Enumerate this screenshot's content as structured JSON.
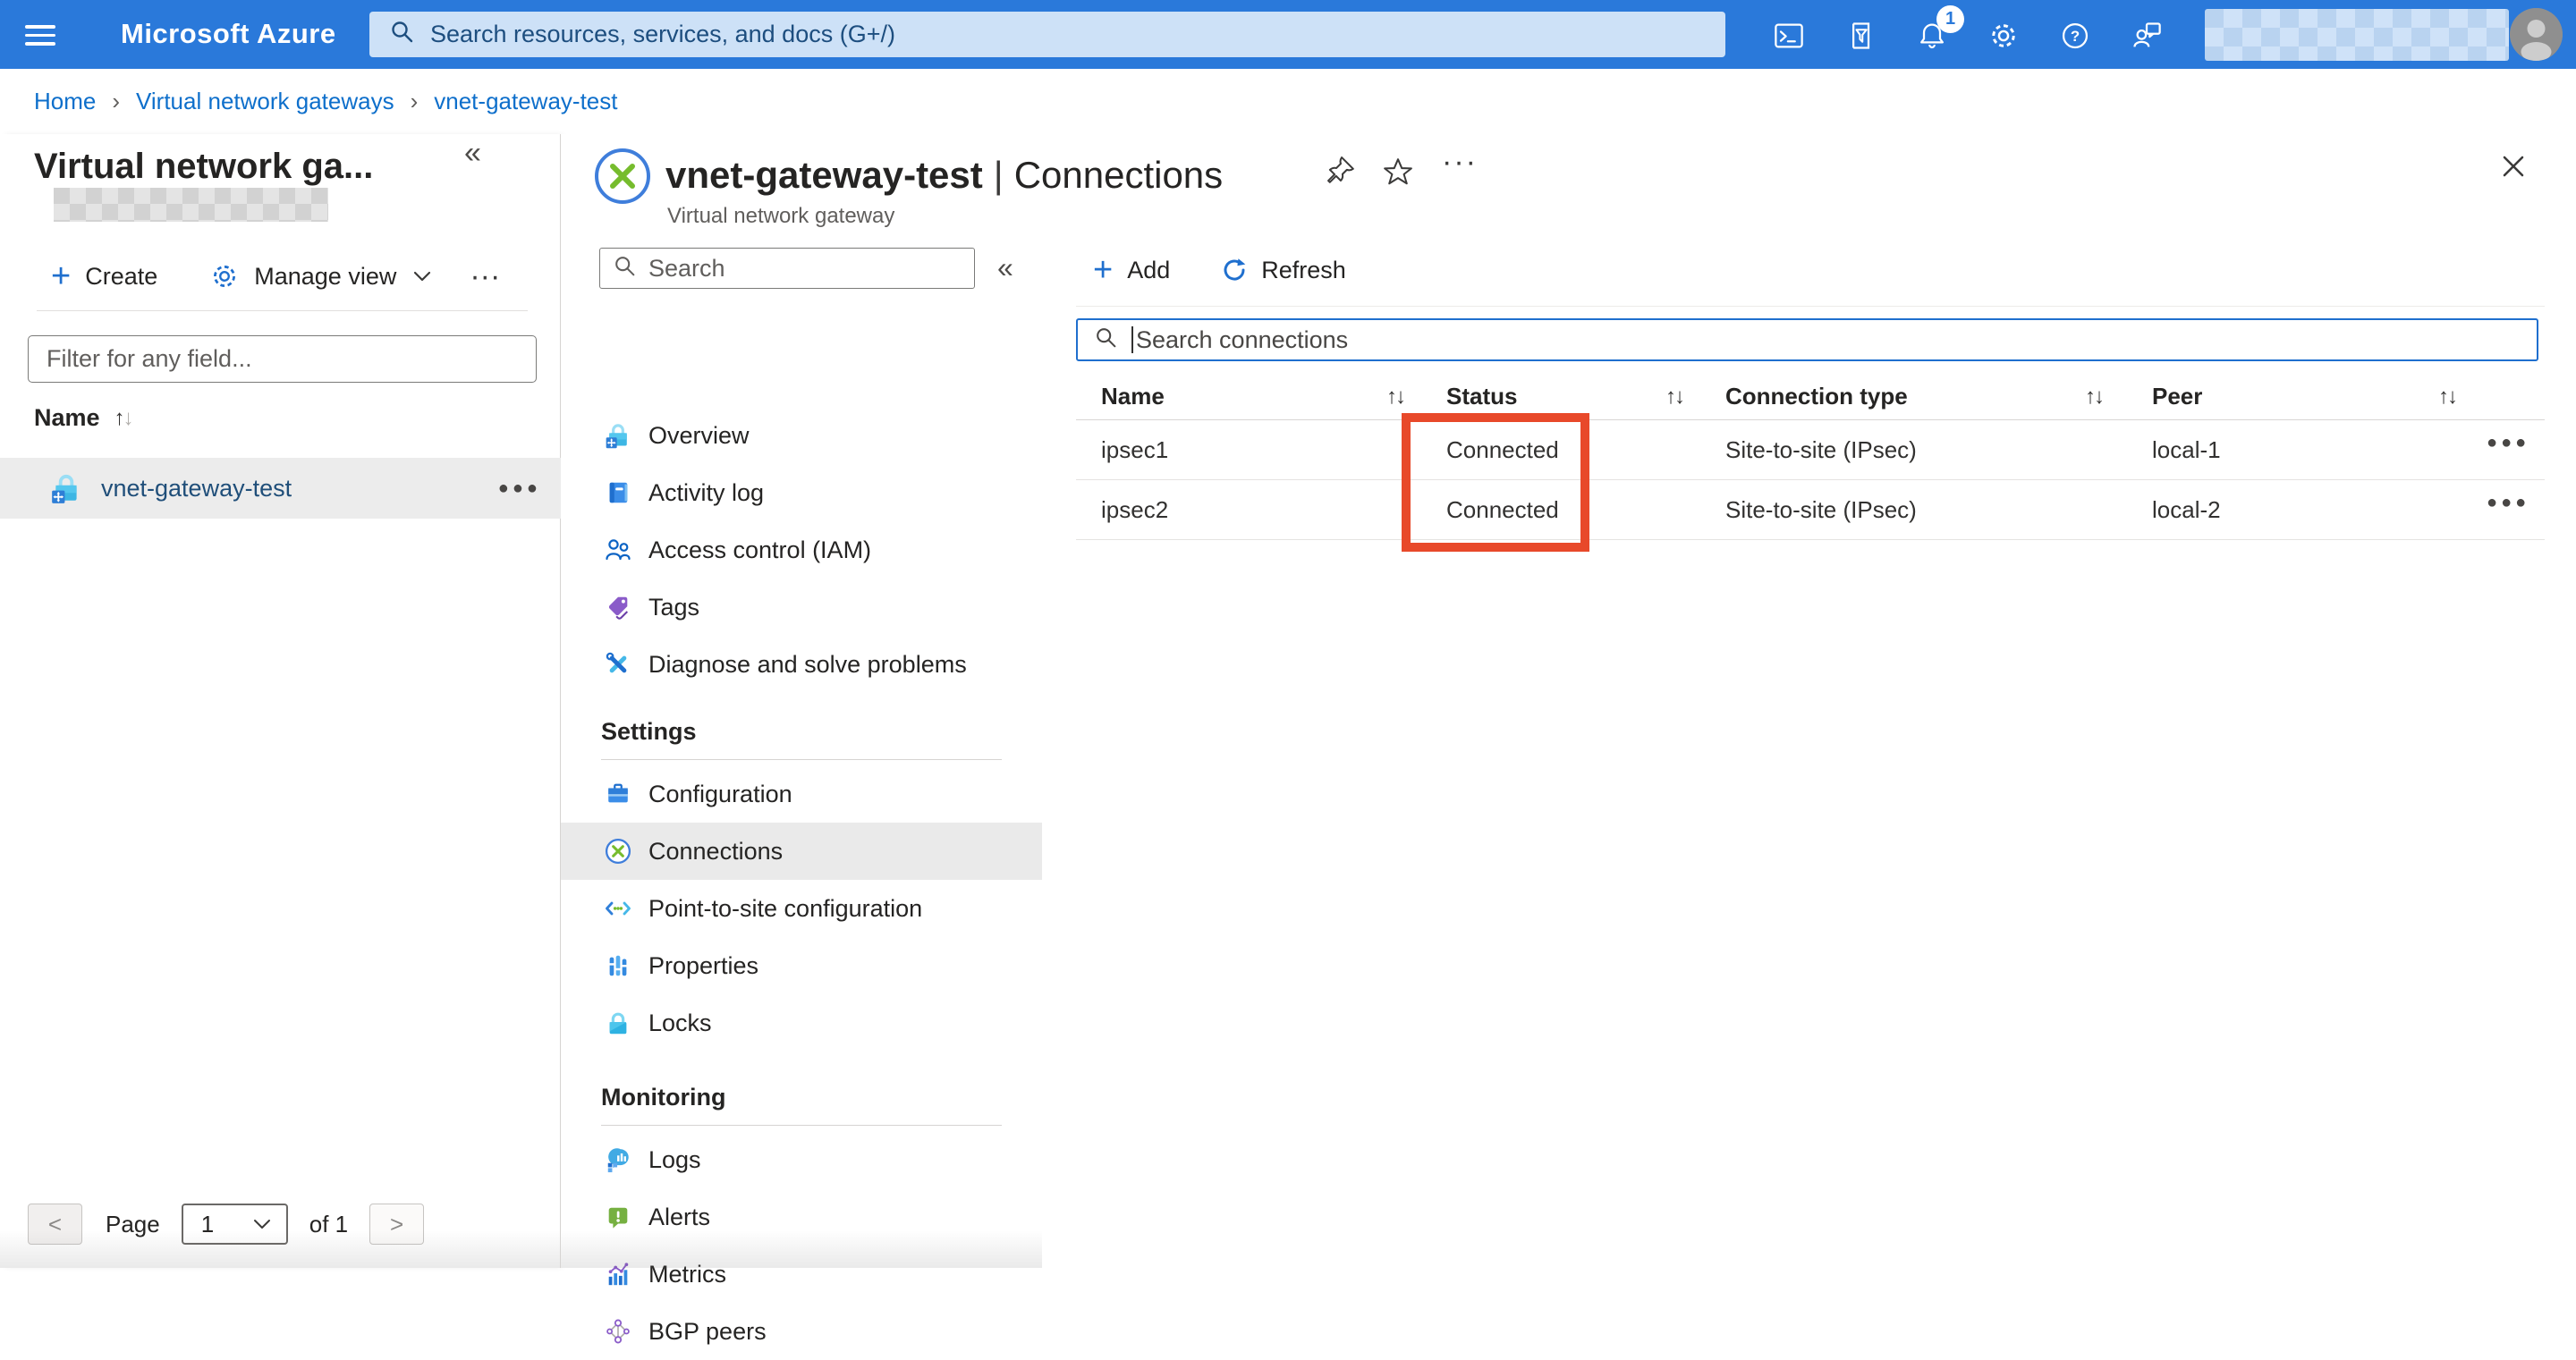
{
  "topbar": {
    "product": "Microsoft Azure",
    "search_placeholder": "Search resources, services, and docs (G+/)",
    "notification_count": "1"
  },
  "glyphs": {
    "collapse": "«",
    "breadcrumb_sep": "›",
    "sort_asc": "↑",
    "sort_desc": "↓",
    "more_h": "⋯",
    "header_more": "···",
    "row_actions": "●●●",
    "plus": "+"
  },
  "breadcrumb": {
    "items": [
      "Home",
      "Virtual network gateways",
      "vnet-gateway-test"
    ]
  },
  "left_panel": {
    "title": "Virtual network ga...",
    "toolbar": {
      "create": "Create",
      "manage_view": "Manage view"
    },
    "filter_placeholder": "Filter for any field...",
    "name_header": "Name",
    "items": [
      {
        "name": "vnet-gateway-test"
      }
    ],
    "pager": {
      "prev": "<",
      "page_label": "Page",
      "page_value": "1",
      "of_label": "of 1",
      "next": ">"
    }
  },
  "blade": {
    "resource_name": "vnet-gateway-test",
    "title_separator": "|",
    "page_name": "Connections",
    "subtitle": "Virtual network gateway",
    "menu": {
      "search_placeholder": "Search",
      "items": [
        {
          "label": "Overview",
          "icon": "gateway-icon"
        },
        {
          "label": "Activity log",
          "icon": "activity-log-icon"
        },
        {
          "label": "Access control (IAM)",
          "icon": "access-control-icon"
        },
        {
          "label": "Tags",
          "icon": "tags-icon"
        },
        {
          "label": "Diagnose and solve problems",
          "icon": "diagnose-icon"
        }
      ],
      "sections": [
        {
          "header": "Settings",
          "items": [
            {
              "label": "Configuration",
              "icon": "configuration-icon"
            },
            {
              "label": "Connections",
              "icon": "connections-icon",
              "selected": true
            },
            {
              "label": "Point-to-site configuration",
              "icon": "point-to-site-icon"
            },
            {
              "label": "Properties",
              "icon": "properties-icon"
            },
            {
              "label": "Locks",
              "icon": "locks-icon"
            }
          ]
        },
        {
          "header": "Monitoring",
          "items": [
            {
              "label": "Logs",
              "icon": "logs-icon"
            },
            {
              "label": "Alerts",
              "icon": "alerts-icon"
            },
            {
              "label": "Metrics",
              "icon": "metrics-icon"
            },
            {
              "label": "BGP peers",
              "icon": "bgp-peers-icon"
            }
          ]
        }
      ]
    }
  },
  "content": {
    "toolbar": {
      "add": "Add",
      "refresh": "Refresh"
    },
    "search_placeholder": "Search connections",
    "table": {
      "columns": [
        "Name",
        "Status",
        "Connection type",
        "Peer"
      ],
      "rows": [
        {
          "name": "ipsec1",
          "status": "Connected",
          "connection_type": "Site-to-site (IPsec)",
          "peer": "local-1"
        },
        {
          "name": "ipsec2",
          "status": "Connected",
          "connection_type": "Site-to-site (IPsec)",
          "peer": "local-2"
        }
      ]
    }
  },
  "annotation": {
    "highlight_color": "#e8492a",
    "highlighted_column": "Status"
  },
  "colors": {
    "topbar": "#2a79da",
    "accent": "#1f6fce",
    "link": "#0e6fcb",
    "selected_bg": "#eaeaea"
  }
}
